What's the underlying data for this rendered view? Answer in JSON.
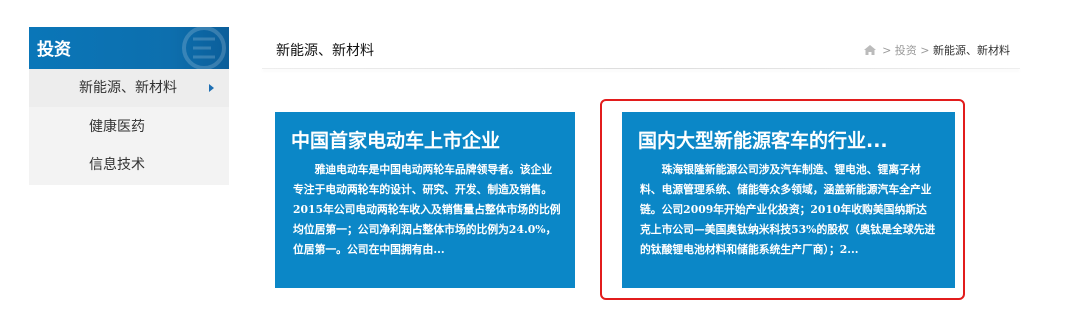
{
  "sidebar": {
    "title": "投资",
    "items": [
      {
        "label": "新能源、新材料",
        "active": true
      },
      {
        "label": "健康医药",
        "active": false
      },
      {
        "label": "信息技术",
        "active": false
      }
    ]
  },
  "header": {
    "title": "新能源、新材料",
    "breadcrumb": {
      "home_icon": "home-icon",
      "separator": ">",
      "items": [
        "投资",
        "新能源、新材料"
      ]
    }
  },
  "cards": [
    {
      "title": "中国首家电动车上市企业",
      "body": "雅迪电动车是中国电动两轮车品牌领导者。该企业专注于电动两轮车的设计、研究、开发、制造及销售。2015年公司电动两轮车收入及销售量占整体市场的比例均位居第一；公司净利润占整体市场的比例为24.0%，位居第一。公司在中国拥有由..."
    },
    {
      "title": "国内大型新能源客车的行业...",
      "body": "珠海银隆新能源公司涉及汽车制造、锂电池、锂离子材料、电源管理系统、储能等众多领域，涵盖新能源汽车全产业链。公司2009年开始产业化投资；2010年收购美国纳斯达克上市公司—美国奥钛纳米科技53%的股权（奥钛是全球先进的钛酸锂电池材料和储能系统生产厂商）；2..."
    }
  ],
  "colors": {
    "card_bg": "#0b87c7",
    "sidebar_header_bg": "#0a76b8",
    "highlight_border": "#e21c1c",
    "arrow": "#1e6fb3"
  }
}
